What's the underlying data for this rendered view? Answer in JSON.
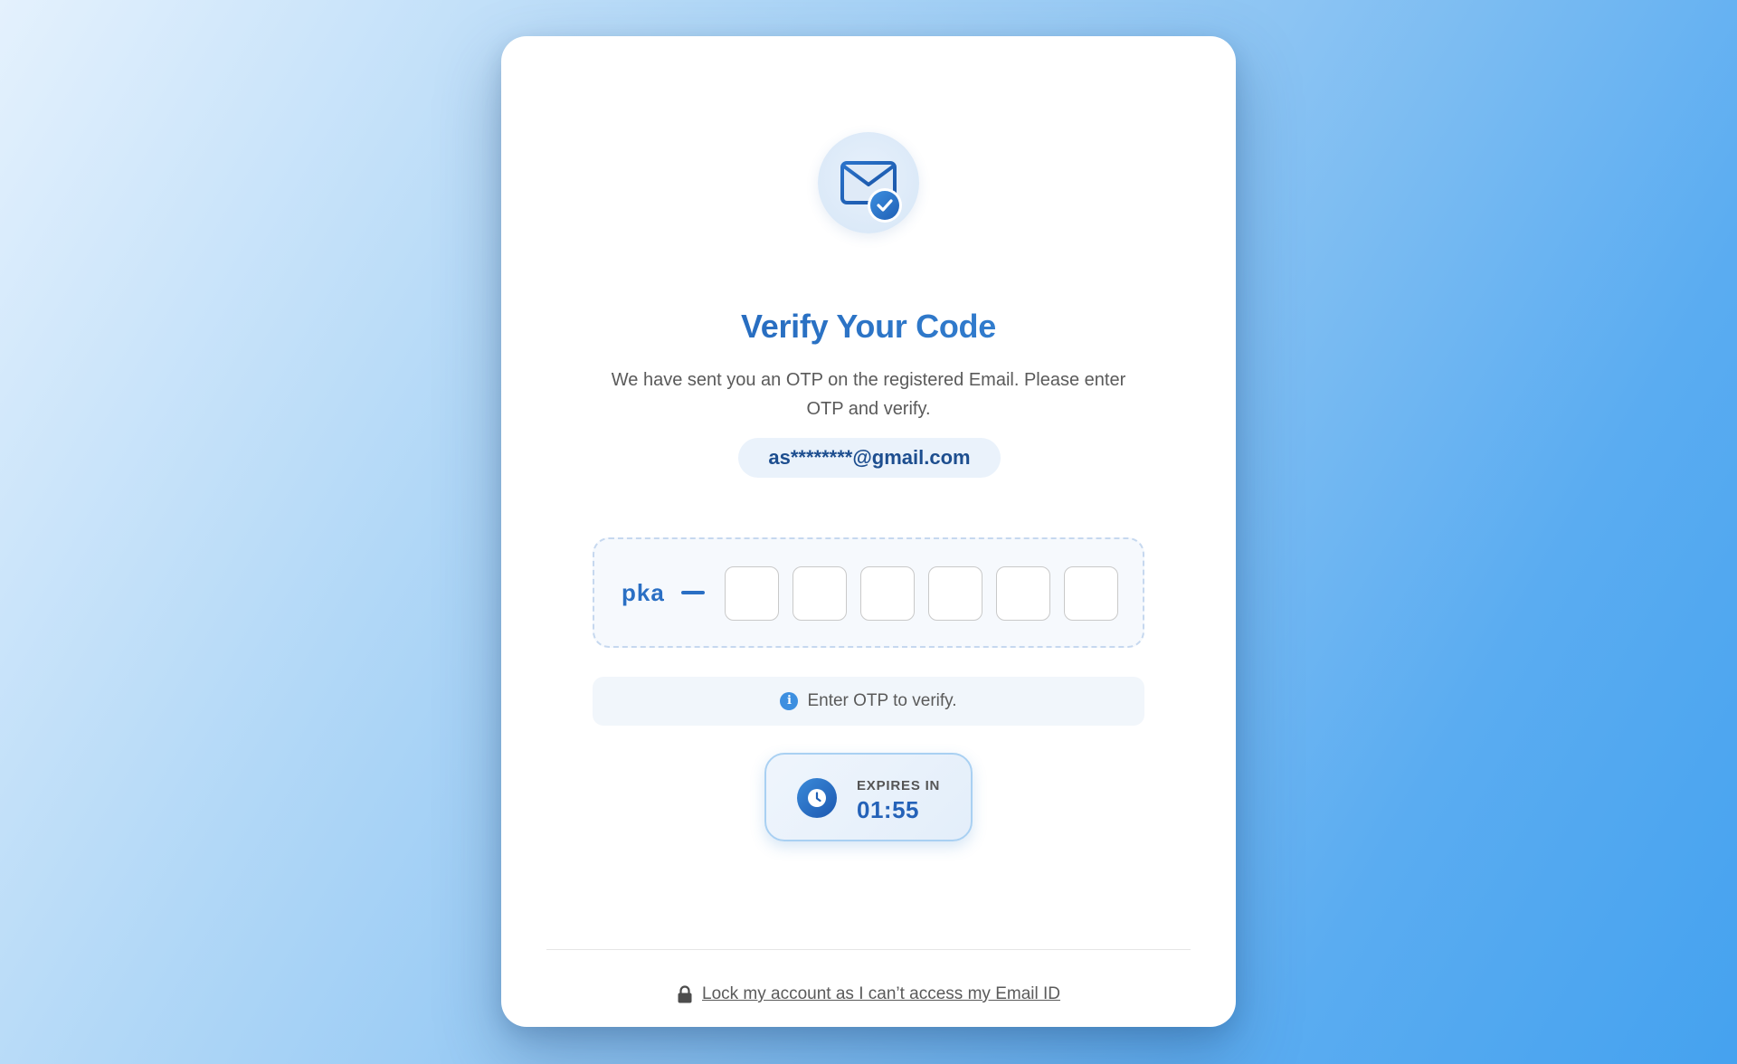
{
  "card": {
    "title": "Verify Your Code",
    "subtitle": "We have sent you an OTP on the registered Email. Please enter OTP and verify.",
    "email": "as********@gmail.com"
  },
  "otp": {
    "prefix": "pka",
    "cells": [
      "",
      "",
      "",
      "",
      "",
      ""
    ]
  },
  "info": {
    "message": "Enter OTP to verify.",
    "icon": "info-icon"
  },
  "timer": {
    "label": "EXPIRES IN",
    "value": "01:55",
    "icon": "clock-icon"
  },
  "footer": {
    "lock_link": "Lock my account as I can’t access my Email ID",
    "icon": "lock-icon"
  },
  "colors": {
    "accent": "#2a70c6",
    "accent_dark": "#1d4e8f",
    "text_muted": "#5a5a5a",
    "card": "#ffffff"
  }
}
